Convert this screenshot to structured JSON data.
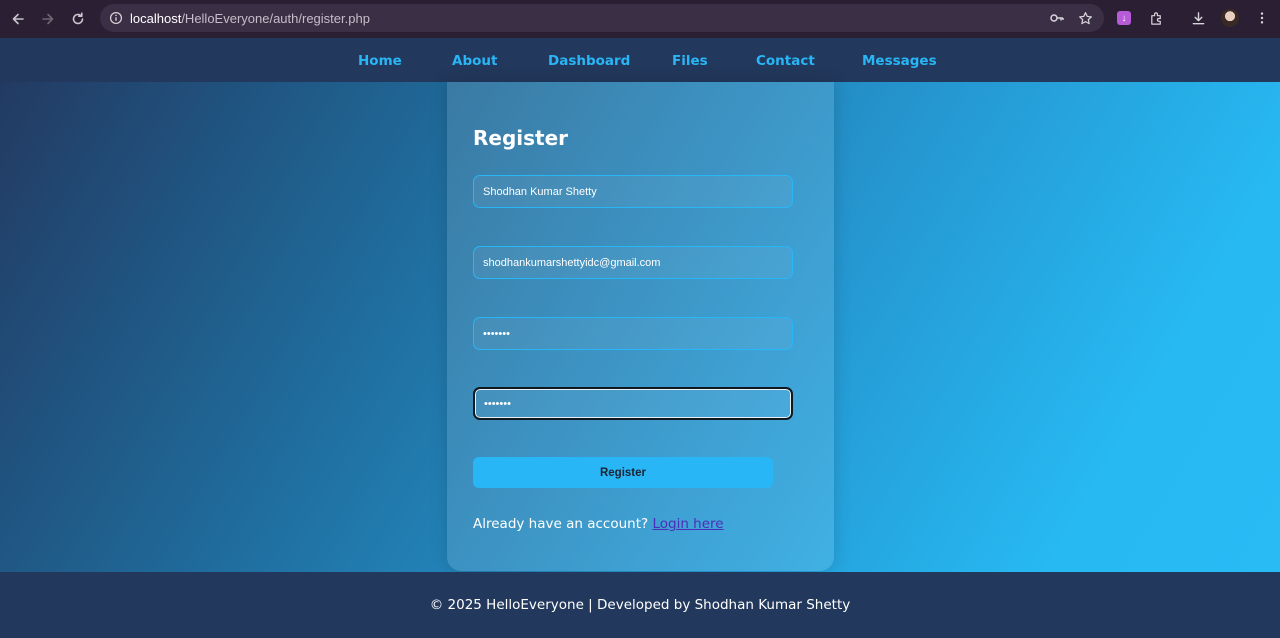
{
  "browser": {
    "url_host": "localhost",
    "url_path": "/HelloEveryone/auth/register.php"
  },
  "nav": {
    "items": [
      "Home",
      "About",
      "Dashboard",
      "Files",
      "Contact",
      "Messages"
    ]
  },
  "form": {
    "title": "Register",
    "name_value": "Shodhan Kumar Shetty",
    "email_value": "shodhankumarshettyidc@gmail.com",
    "password_value": "•••••••",
    "confirm_value": "•••••••",
    "submit_label": "Register",
    "login_prompt": "Already have an account?",
    "login_link": "Login here"
  },
  "footer": {
    "text": "© 2025 HelloEveryone | Developed by Shodhan Kumar Shetty"
  },
  "colors": {
    "accent": "#29b6f6",
    "nav_bg": "#22385c",
    "link_visited": "#4b2fb8"
  }
}
